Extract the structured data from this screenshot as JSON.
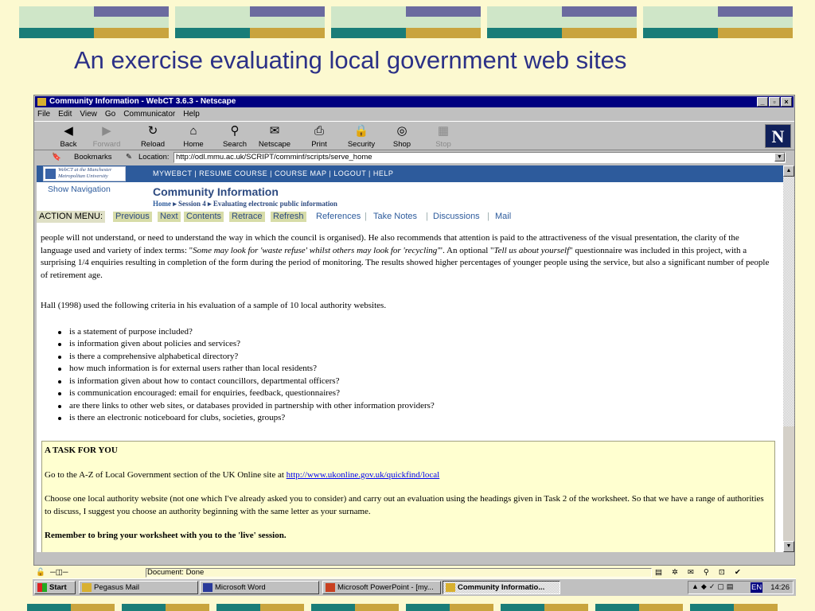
{
  "slide": {
    "title": "An exercise evaluating local government web sites",
    "colors": {
      "background": "#fcf9d0",
      "title": "#2c3187",
      "band_teal": "#1a7d78",
      "band_gold": "#c9a43e",
      "band_purple": "#6b6b9f",
      "band_mint": "#cfe6c8"
    }
  },
  "window": {
    "title": "Community Information - WebCT 3.6.3 - Netscape",
    "menu": [
      "File",
      "Edit",
      "View",
      "Go",
      "Communicator",
      "Help"
    ],
    "toolbar": [
      {
        "label": "Back",
        "icon": "back-arrow-icon",
        "glyph": "◀"
      },
      {
        "label": "Forward",
        "icon": "forward-arrow-icon",
        "glyph": "▶",
        "disabled": true
      },
      {
        "label": "Reload",
        "icon": "reload-icon",
        "glyph": "↻"
      },
      {
        "label": "Home",
        "icon": "home-icon",
        "glyph": "⌂"
      },
      {
        "label": "Search",
        "icon": "search-icon",
        "glyph": "⚲"
      },
      {
        "label": "Netscape",
        "icon": "netscape-icon",
        "glyph": "✉"
      },
      {
        "label": "Print",
        "icon": "print-icon",
        "glyph": "⎙"
      },
      {
        "label": "Security",
        "icon": "lock-icon",
        "glyph": "🔒"
      },
      {
        "label": "Shop",
        "icon": "shop-icon",
        "glyph": "◎"
      },
      {
        "label": "Stop",
        "icon": "stop-icon",
        "glyph": "▦",
        "disabled": true
      }
    ],
    "bookmarks_label": "Bookmarks",
    "location_label": "Location:",
    "location_value": "http://odl.mmu.ac.uk/SCRIPT/comminf/scripts/serve_home",
    "status": "Document: Done"
  },
  "webct": {
    "logo_text": "WebCT at the Manchester Metropolitan University",
    "nav": "MYWEBCT  |  RESUME COURSE  |  COURSE MAP  |  LOGOUT  |  HELP",
    "show_navigation": "Show Navigation",
    "page_title": "Community Information",
    "breadcrumb": {
      "home": "Home",
      "session": "Session 4",
      "current": "Evaluating electronic public information"
    },
    "action_menu_label": "ACTION MENU:",
    "action_items": [
      "Previous",
      "Next",
      "Contents",
      "Retrace",
      "Refresh"
    ],
    "plain_items": [
      "References",
      "Take Notes",
      "Discussions",
      "Mail"
    ]
  },
  "content": {
    "para1": {
      "a": "people will not understand, or need to understand the way in which the council is organised).  He also recommends that attention is paid to the attractiveness of the visual presentation, the clarity of the language used and variety of index terms: \"",
      "quote": "Some may look for 'waste refuse' whilst others may look for 'recycling'",
      "b": "\".  An optional \"",
      "quote2": "Tell us about yourself",
      "c": "\" questionnaire was included in this project, with a surprising 1/4 enquiries resulting in completion of the form during the period of monitoring.  The results showed higher percentages of younger people using the service, but also a significant number of people of retirement age."
    },
    "para2": "Hall (1998) used the following criteria in his evaluation of a sample of 10 local authority websites.",
    "criteria": [
      "is a statement of purpose included?",
      "is information given about policies and services?",
      "is there a comprehensive alphabetical directory?",
      "how much information is for external users rather than local residents?",
      "is information given about how to contact councillors, departmental officers?",
      "is communication encouraged: email for enquiries, feedback, questionnaires?",
      "are there links to other web sites, or databases provided in partnership with other information providers?",
      "is there an electronic noticeboard for clubs, societies, groups?"
    ],
    "task": {
      "heading": "A TASK FOR YOU",
      "line1": "Go to the A-Z of Local Government section of the UK Online site at",
      "link": "http://www.ukonline.gov.uk/quickfind/local",
      "line2": "Choose one local authority website (not one which I've already asked you to consider) and carry out an evaluation using the headings given in Task 2 of the worksheet.  So that we have a range of authorities to discuss, I suggest you choose an authority beginning with the same letter as your surname.",
      "reminder": "Remember to bring your worksheet with you to the 'live' session."
    }
  },
  "taskbar": {
    "start": "Start",
    "items": [
      {
        "label": "Pegasus Mail",
        "active": false
      },
      {
        "label": "Microsoft Word",
        "active": false
      },
      {
        "label": "Microsoft PowerPoint - [my...",
        "active": false
      },
      {
        "label": "Community Informatio...",
        "active": true
      }
    ],
    "lang": "EN",
    "time": "14:26"
  }
}
